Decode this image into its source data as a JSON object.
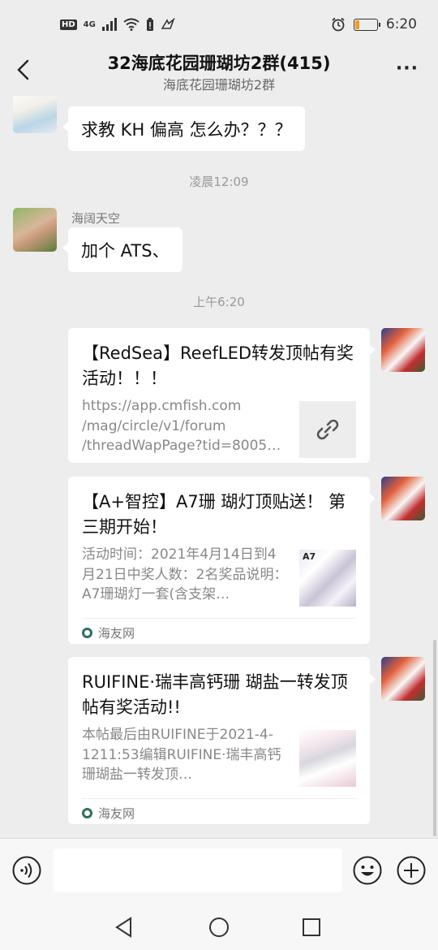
{
  "status_bar": {
    "hd": "HD",
    "network": "4G",
    "battery_level": 0.2,
    "time": "6:20"
  },
  "header": {
    "title": "32海底花园珊瑚坊2群(415)",
    "subtitle": "海底花园珊瑚坊2群",
    "more_label": "···"
  },
  "messages": {
    "m1_text": "求教   KH 偏高  怎么办？？？",
    "time1": "凌晨12:09",
    "m2_sender": "海阔天空",
    "m2_text": "加个 ATS、",
    "time2": "上午6:20"
  },
  "cards": [
    {
      "title": "【RedSea】ReefLED转发顶帖有奖活动！！！",
      "desc": "https://app.cmfish.com\n/mag/circle/v1/forum\n/threadWapPage?tid=8005…",
      "thumb_icon": "link-icon"
    },
    {
      "title": "【A+智控】A7珊 瑚灯顶贴送！ 第三期开始！",
      "desc": "活动时间：2021年4月14日到4月21日中奖人数：2名奖品说明：A7珊瑚灯一套(含支架…",
      "thumb_label": "A7",
      "source": "海友网"
    },
    {
      "title": "RUIFINE·瑞丰高钙珊 瑚盐一转发顶帖有奖活动!!",
      "desc": "本帖最后由RUIFINE于2021-4-1211:53编辑RUIFINE·瑞丰高钙珊瑚盐一转发顶…",
      "source": "海友网"
    }
  ],
  "input": {
    "placeholder": ""
  },
  "icons": {
    "voice": "voice-icon",
    "emoji": "emoji-icon",
    "plus": "plus-icon",
    "back": "back-arrow-icon",
    "nav_back": "nav-back-icon",
    "nav_home": "nav-home-icon",
    "nav_recent": "nav-recent-icon"
  },
  "colors": {
    "chat_bg": "#ededed",
    "bubble_bg": "#ffffff",
    "battery": "#f29d1e"
  }
}
